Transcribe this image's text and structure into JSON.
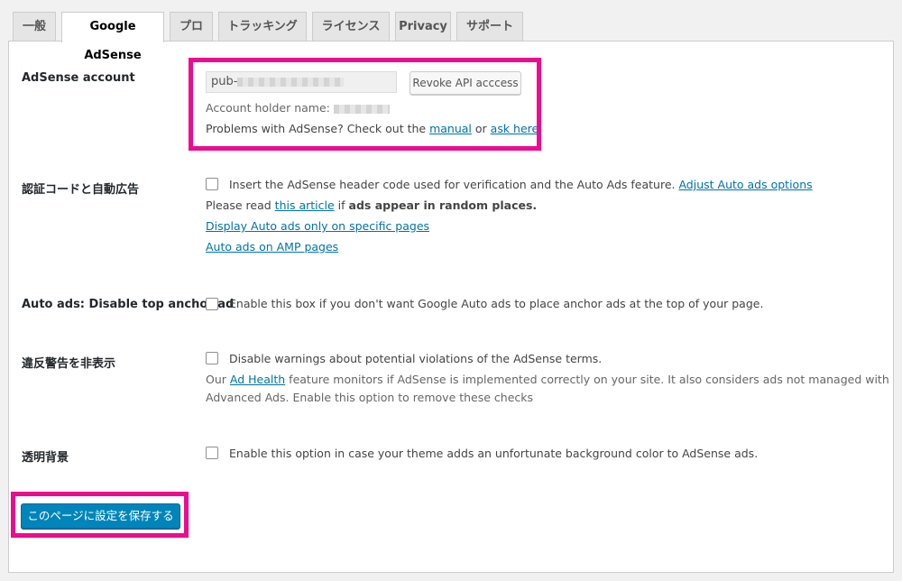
{
  "tabs": [
    {
      "label": "一般"
    },
    {
      "label": "Google AdSense"
    },
    {
      "label": "プロ"
    },
    {
      "label": "トラッキング"
    },
    {
      "label": "ライセンス"
    },
    {
      "label": "Privacy"
    },
    {
      "label": "サポート"
    }
  ],
  "adsense": {
    "label": "AdSense account",
    "publisher_prefix": "pub-",
    "revoke_button": "Revoke API acccess",
    "holder_label": "Account holder name:",
    "problems_text": "Problems with AdSense? Check out the",
    "manual_link": "manual",
    "or_text": "or",
    "ask_link": "ask here",
    "period": "."
  },
  "autoads": {
    "label": "認証コードと自動広告",
    "checkbox_text": "Insert the AdSense header code used for verification and the Auto Ads feature.",
    "adjust_link": "Adjust Auto ads options",
    "read_text": "Please read",
    "article_link": "this article",
    "if_text": "if",
    "random_text": "ads appear in random places.",
    "specific_link": "Display Auto ads only on specific pages",
    "amp_link": "Auto ads on AMP pages"
  },
  "anchor": {
    "label": "Auto ads: Disable top anchor ad",
    "checkbox_text": "Enable this box if you don't want Google Auto ads to place anchor ads at the top of your page."
  },
  "violations": {
    "label": "違反警告を非表示",
    "checkbox_text": "Disable warnings about potential violations of the AdSense terms.",
    "desc_prefix": "Our",
    "ad_health_link": "Ad Health",
    "desc_line1": "feature monitors if AdSense is implemented correctly on your site. It also considers ads not managed with",
    "desc_line2": "Advanced Ads. Enable this option to remove these checks"
  },
  "transparent": {
    "label": "透明背景",
    "checkbox_text": "Enable this option in case your theme adds an unfortunate background color to AdSense ads."
  },
  "save_button": "このページに設定を保存する",
  "colors": {
    "highlight": "#ec0c8e",
    "primary": "#0085ba",
    "link": "#0073aa"
  }
}
